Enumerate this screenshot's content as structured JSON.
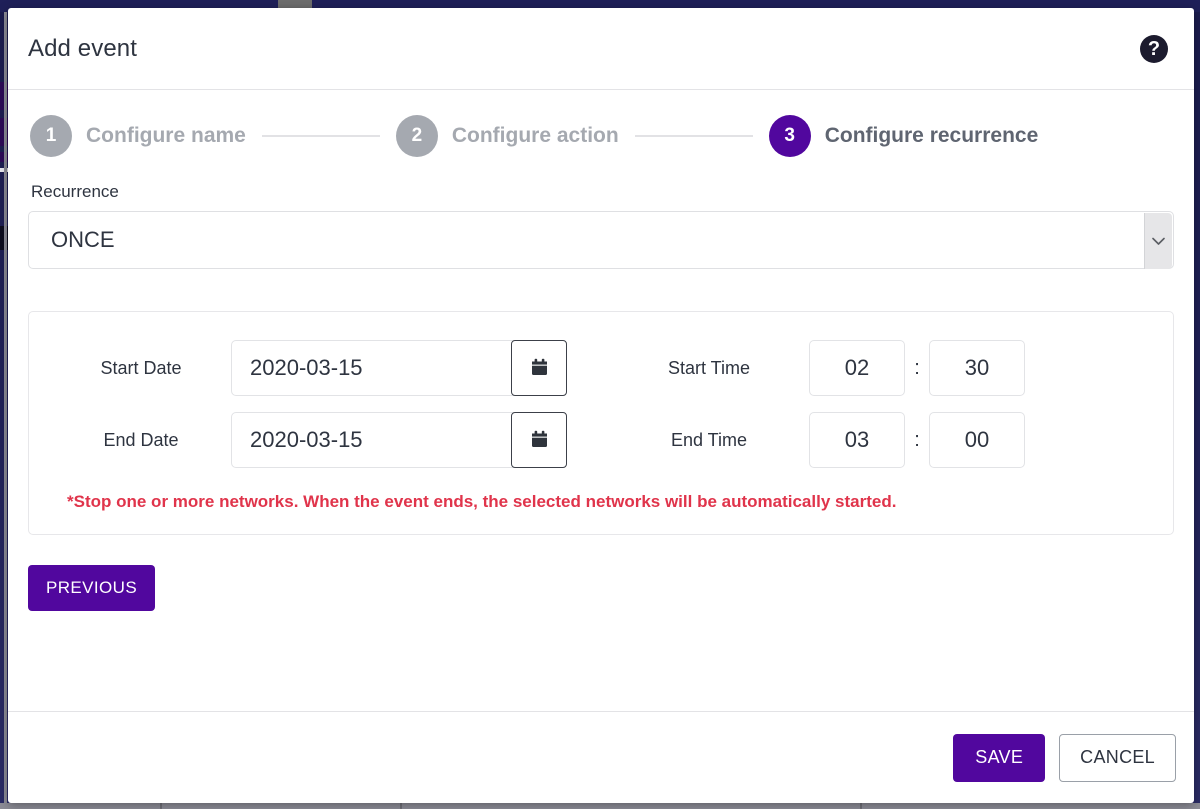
{
  "modal": {
    "title": "Add event",
    "help_icon": "help-circle-icon",
    "colors": {
      "primary_purple": "#51079e",
      "step_inactive": "#a5a9b0",
      "warning_red": "#e0344b",
      "backdrop_navy": "#1c1d52"
    }
  },
  "stepper": {
    "steps": [
      {
        "number": "1",
        "label": "Configure name",
        "active": false
      },
      {
        "number": "2",
        "label": "Configure action",
        "active": false
      },
      {
        "number": "3",
        "label": "Configure recurrence",
        "active": true
      }
    ]
  },
  "recurrence": {
    "label": "Recurrence",
    "value": "ONCE",
    "arrow_icon": "chevron-down-icon",
    "options": [
      "ONCE"
    ]
  },
  "schedule": {
    "start_date": {
      "label": "Start Date",
      "value": "2020-03-15",
      "calendar_icon": "calendar-icon"
    },
    "end_date": {
      "label": "End Date",
      "value": "2020-03-15",
      "calendar_icon": "calendar-icon"
    },
    "start_time": {
      "label": "Start Time",
      "hours": "02",
      "separator": ":",
      "minutes": "30"
    },
    "end_time": {
      "label": "End Time",
      "hours": "03",
      "separator": ":",
      "minutes": "00"
    },
    "warning": "*Stop one or more networks. When the event ends, the selected networks will be automatically started."
  },
  "actions": {
    "previous_label": "PREVIOUS",
    "save_label": "SAVE",
    "cancel_label": "CANCEL"
  }
}
